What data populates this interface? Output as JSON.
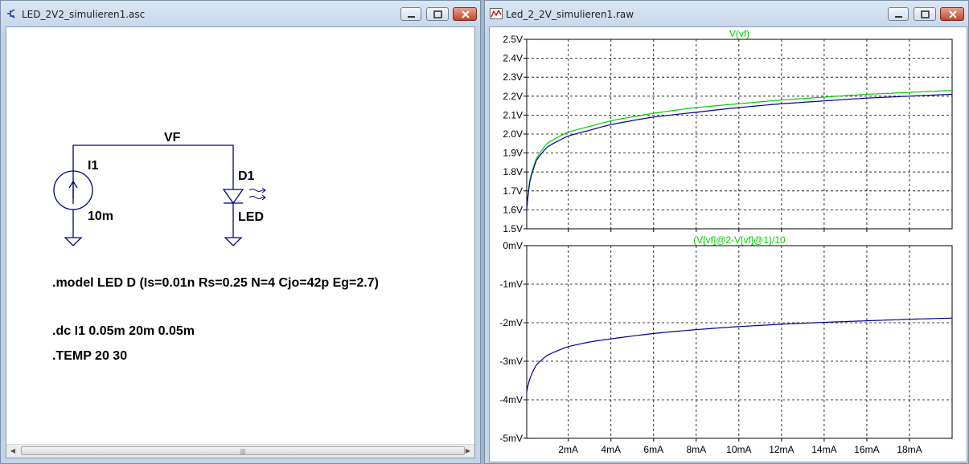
{
  "schematic_window": {
    "title": "LED_2V2_simulieren1.asc",
    "labels": {
      "net": "VF",
      "source_name": "I1",
      "source_value": "10m",
      "diode_name": "D1",
      "diode_model": "LED"
    },
    "directives": {
      "model": ".model LED D (Is=0.01n Rs=0.25 N=4 Cjo=42p Eg=2.7)",
      "dc": ".dc I1 0.05m 20m 0.05m",
      "temp": ".TEMP 20 30"
    },
    "scrollbar_grip": "|||"
  },
  "waveform_window": {
    "title": "Led_2_2V_simulieren1.raw"
  },
  "colors": {
    "trace_green": "#00d000",
    "trace_blue": "#000098",
    "wire": "#000080",
    "grid": "#000000"
  },
  "chart_data": [
    {
      "type": "line",
      "title": "V(vf)",
      "x_range_mA": [
        0.05,
        20
      ],
      "x_ticks": [
        "2mA",
        "4mA",
        "6mA",
        "8mA",
        "10mA",
        "12mA",
        "14mA",
        "16mA",
        "18mA"
      ],
      "y_ticks": [
        "1.5V",
        "1.6V",
        "1.7V",
        "1.8V",
        "1.9V",
        "2.0V",
        "2.1V",
        "2.2V",
        "2.3V",
        "2.4V",
        "2.5V"
      ],
      "ylim": [
        1.5,
        2.5
      ],
      "grid": true,
      "series": [
        {
          "color": "green",
          "x": [
            0.05,
            0.2,
            0.5,
            1,
            2,
            3,
            4,
            6,
            8,
            10,
            12,
            14,
            16,
            18,
            20
          ],
          "values": [
            1.6,
            1.76,
            1.87,
            1.95,
            2.01,
            2.04,
            2.07,
            2.11,
            2.14,
            2.16,
            2.18,
            2.195,
            2.21,
            2.22,
            2.23
          ]
        },
        {
          "color": "blue",
          "x": [
            0.05,
            0.2,
            0.5,
            1,
            2,
            3,
            4,
            6,
            8,
            10,
            12,
            14,
            16,
            18,
            20
          ],
          "values": [
            1.6,
            1.75,
            1.86,
            1.93,
            1.99,
            2.02,
            2.05,
            2.09,
            2.115,
            2.14,
            2.16,
            2.175,
            2.19,
            2.2,
            2.21
          ]
        }
      ]
    },
    {
      "type": "line",
      "title": "(V[vf]@2-V[vf]@1)/10",
      "x_range_mA": [
        0.05,
        20
      ],
      "x_ticks": [
        "2mA",
        "4mA",
        "6mA",
        "8mA",
        "10mA",
        "12mA",
        "14mA",
        "16mA",
        "18mA"
      ],
      "y_ticks": [
        "0mV",
        "-1mV",
        "-2mV",
        "-3mV",
        "-4mV",
        "-5mV"
      ],
      "ylim": [
        -5,
        0
      ],
      "grid": true,
      "series": [
        {
          "color": "blue",
          "x": [
            0.05,
            0.2,
            0.5,
            1,
            2,
            3,
            4,
            6,
            8,
            10,
            12,
            14,
            16,
            18,
            20
          ],
          "values": [
            -3.8,
            -3.45,
            -3.1,
            -2.85,
            -2.62,
            -2.5,
            -2.42,
            -2.28,
            -2.18,
            -2.1,
            -2.04,
            -1.99,
            -1.95,
            -1.91,
            -1.88
          ]
        }
      ]
    }
  ]
}
